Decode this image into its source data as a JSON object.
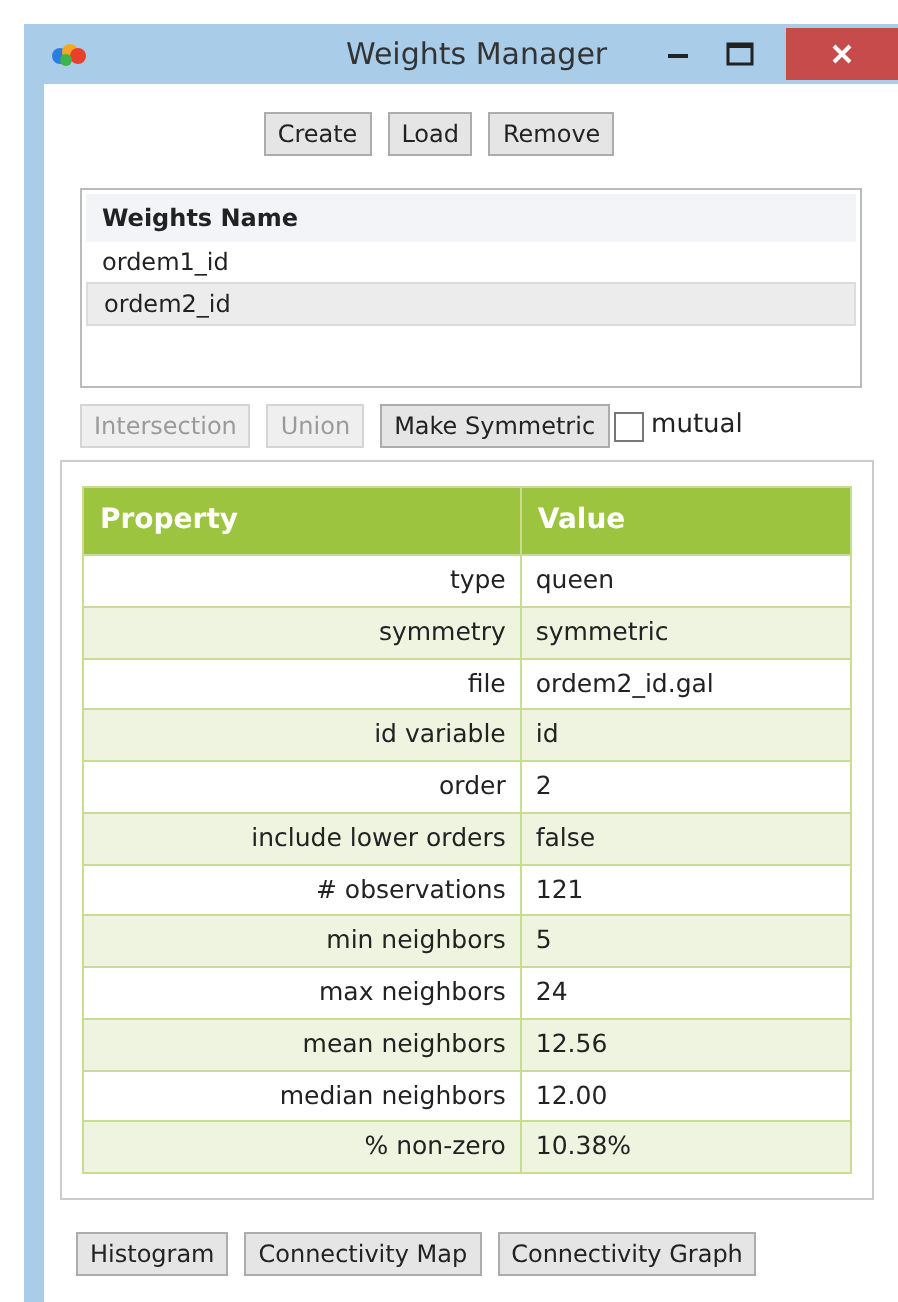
{
  "window": {
    "title": "Weights Manager"
  },
  "top_buttons": [
    {
      "label": "Create"
    },
    {
      "label": "Load"
    },
    {
      "label": "Remove"
    }
  ],
  "weights_list": {
    "header": "Weights Name",
    "items": [
      {
        "label": "ordem1_id",
        "selected": false
      },
      {
        "label": "ordem2_id",
        "selected": true
      }
    ]
  },
  "operation_buttons": [
    {
      "label": "Intersection",
      "disabled": true
    },
    {
      "label": "Union",
      "disabled": true
    },
    {
      "label": "Make Symmetric",
      "disabled": false
    }
  ],
  "mutual": {
    "label": "mutual",
    "checked": false
  },
  "properties": {
    "columns": [
      "Property",
      "Value"
    ],
    "rows": [
      {
        "property": "type",
        "value": "queen"
      },
      {
        "property": "symmetry",
        "value": "symmetric"
      },
      {
        "property": "file",
        "value": "ordem2_id.gal"
      },
      {
        "property": "id variable",
        "value": "id"
      },
      {
        "property": "order",
        "value": "2"
      },
      {
        "property": "include lower orders",
        "value": "false"
      },
      {
        "property": "# observations",
        "value": "121"
      },
      {
        "property": "min neighbors",
        "value": "5"
      },
      {
        "property": "max neighbors",
        "value": "24"
      },
      {
        "property": "mean neighbors",
        "value": "12.56"
      },
      {
        "property": "median neighbors",
        "value": "12.00"
      },
      {
        "property": "% non-zero",
        "value": "10.38%"
      }
    ]
  },
  "bottom_buttons": [
    {
      "label": "Histogram"
    },
    {
      "label": "Connectivity Map"
    },
    {
      "label": "Connectivity Graph"
    }
  ]
}
